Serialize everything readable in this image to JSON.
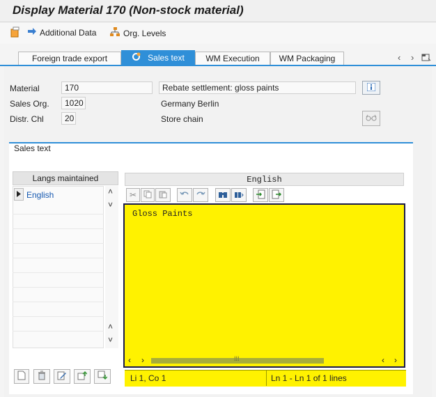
{
  "window": {
    "title": "Display Material 170 (Non-stock material)"
  },
  "toolbar": {
    "additional_data": "Additional Data",
    "org_levels": "Org. Levels"
  },
  "tabs": [
    {
      "label": "Foreign trade export"
    },
    {
      "label": "Sales text"
    },
    {
      "label": "WM Execution"
    },
    {
      "label": "WM Packaging"
    }
  ],
  "header": {
    "material_label": "Material",
    "material_value": "170",
    "material_desc": "Rebate settlement: gloss paints",
    "sales_org_label": "Sales Org.",
    "sales_org_value": "1020",
    "sales_org_desc": "Germany Berlin",
    "distr_chl_label": "Distr. Chl",
    "distr_chl_value": "20",
    "distr_chl_desc": "Store chain"
  },
  "sales_text": {
    "group_title": "Sales text",
    "langs_header": "Langs maintained",
    "langs": [
      "English"
    ],
    "editor_header": "English",
    "editor_text": "Gloss Paints",
    "status_position": "Li 1, Co 1",
    "status_lines": "Ln 1 - Ln 1 of 1 lines"
  },
  "colors": {
    "accent": "#2f8fd8",
    "editor_bg": "#fff200",
    "link_blue": "#1558b0"
  }
}
